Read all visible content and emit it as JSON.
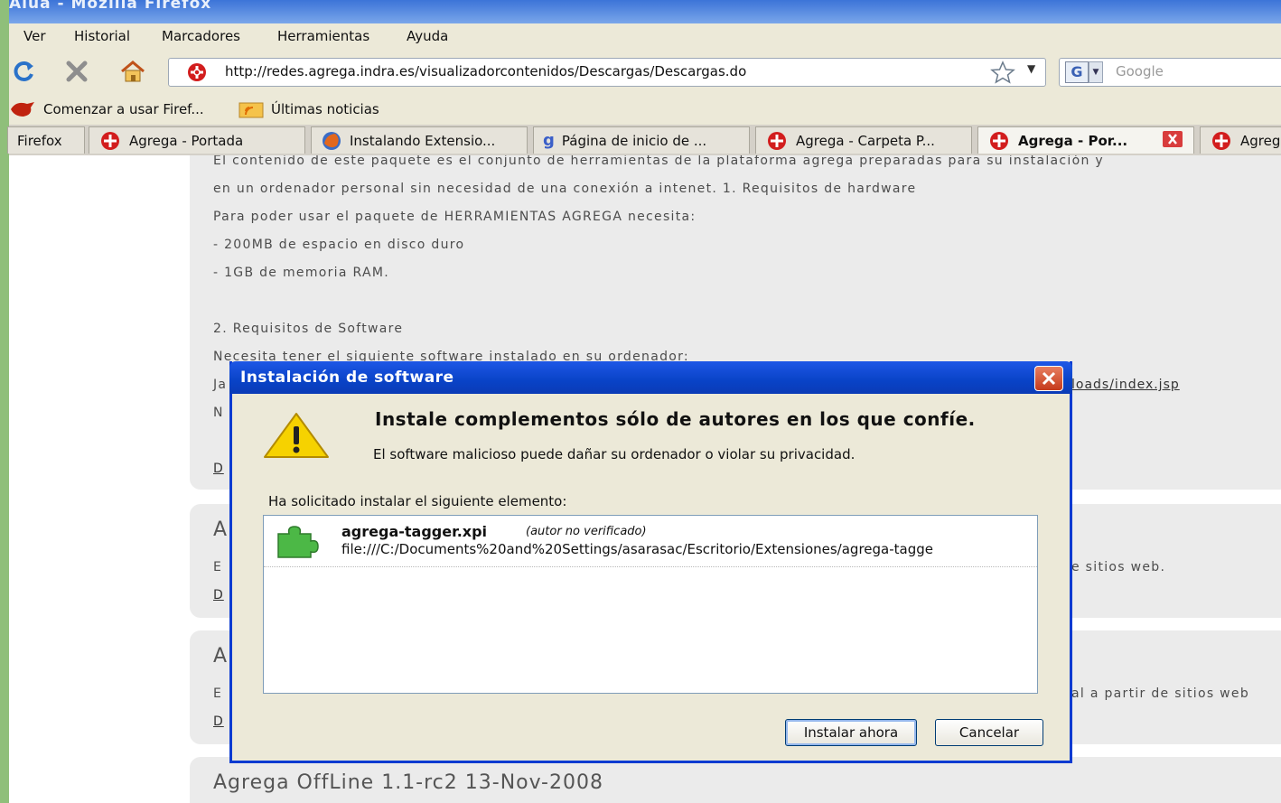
{
  "window": {
    "title": "Alua - Mozilla Firefox"
  },
  "menu": [
    "Ver",
    "Historial",
    "Marcadores",
    "Herramientas",
    "Ayuda"
  ],
  "toolbar": {
    "url": "http://redes.agrega.indra.es/visualizadorcontenidos/Descargas/Descargas.do",
    "search_placeholder": "Google"
  },
  "bookmarks": [
    "Comenzar a usar Firef...",
    "Últimas noticias"
  ],
  "tabs": [
    "Firefox",
    "Agrega - Portada",
    "Instalando Extensio...",
    "Página de inicio de ...",
    "Agrega - Carpeta P...",
    "Agrega - Por...",
    "Agreg"
  ],
  "page": {
    "lines": [
      "El contenido de este paquete es el conjunto de herramientas de la plataforma agrega preparadas para su instalación y",
      "en un ordenador personal sin necesidad de una conexión a intenet. 1. Requisitos de hardware",
      "Para poder usar el paquete de HERRAMIENTAS AGREGA necesita:",
      "- 200MB de espacio en disco duro",
      "- 1GB de memoria RAM.",
      "2. Requisitos de Software",
      "Necesita tener el siguiente software instalado en su ordenador:"
    ],
    "frag_ja": "Ja",
    "frag_link": "loads/index.jsp",
    "frag_n": "N",
    "frag_d": "D",
    "frag_a": "A",
    "frag_e": "E",
    "frag_sitios1": "e sitios web.",
    "frag_sitios2": "al a partir de sitios web",
    "bottom_title": "Agrega OffLine 1.1-rc2 13-Nov-2008"
  },
  "dialog": {
    "title": "Instalación de software",
    "headline": "Instale complementos sólo de autores en los que confíe.",
    "subline": "El software malicioso puede dañar su ordenador o violar su privacidad.",
    "requested": "Ha solicitado instalar el siguiente elemento:",
    "item": {
      "name": "agrega-tagger.xpi",
      "note": "(autor no verificado)",
      "path": "file:///C:/Documents%20and%20Settings/asarasac/Escritorio/Extensiones/agrega-tagge"
    },
    "install_button": "Instalar ahora",
    "cancel_button": "Cancelar"
  },
  "colors": {
    "dialog_title": "#0943c7",
    "close": "#c53a1c",
    "chrome": "#ece9d8"
  }
}
